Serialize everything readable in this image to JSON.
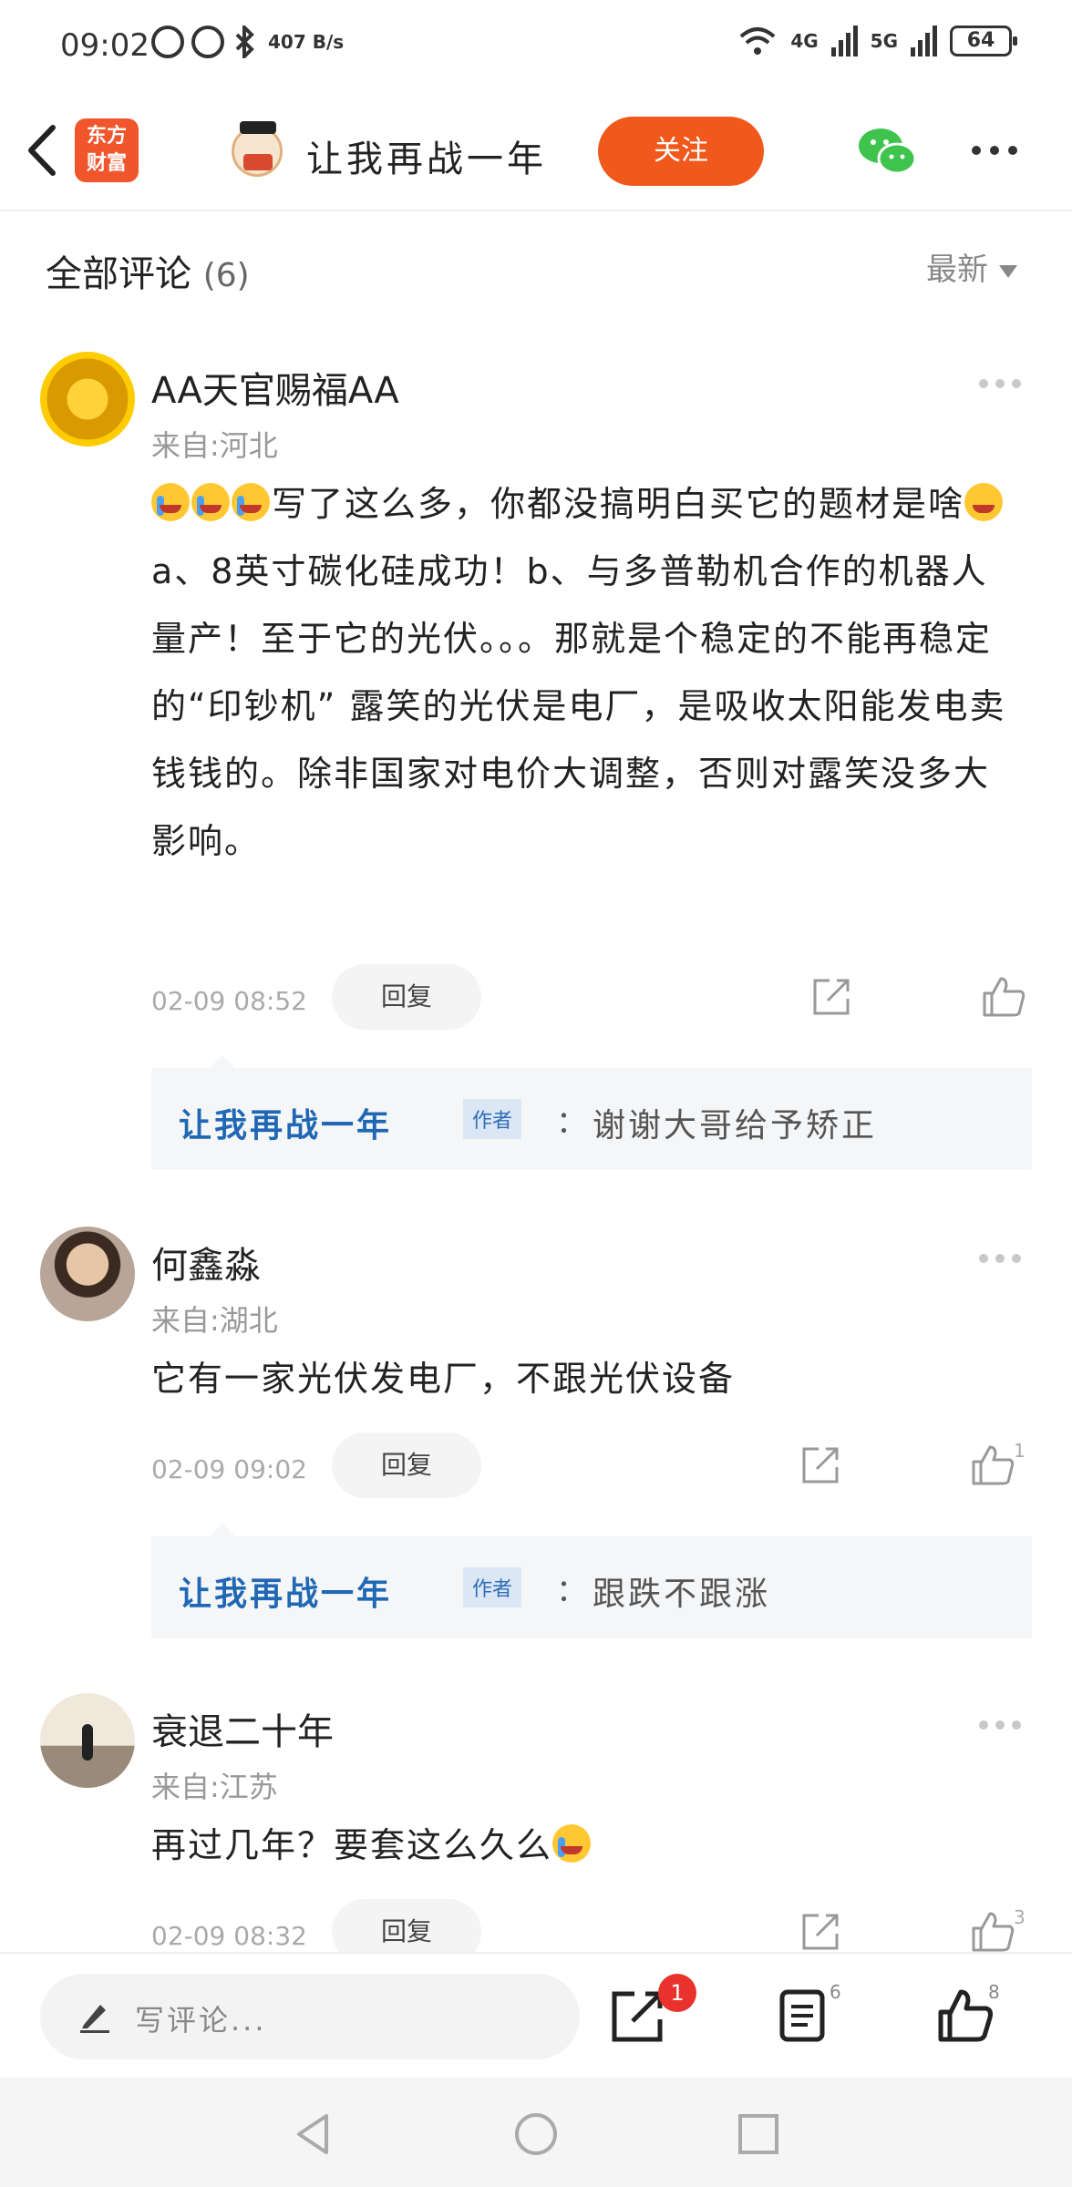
{
  "status_bar": {
    "time": "09:02",
    "net_speed": "407 B/s",
    "net_4g": "4G",
    "net_5g": "5G",
    "battery": "64"
  },
  "header": {
    "logo_text_1": "东方",
    "logo_text_2": "财富",
    "title": "让我再战一年",
    "follow_label": "关注"
  },
  "section": {
    "title": "全部评论",
    "count": "(6)",
    "sort_label": "最新"
  },
  "comments": [
    {
      "name": "AA天官赐福AA",
      "location": "来自:河北",
      "text": "写了这么多，你都没搞明白买它的题材是啥",
      "text_2": "a、8英寸碳化硅成功！b、与多普勒机合作的机器人量产！至于它的光伏。。。那就是个稳定的不能再稳定的“印钞机” 露笑的光伏是电厂，是吸收太阳能发电卖钱钱的。除非国家对电价大调整，否则对露笑没多大影响。",
      "time": "02-09  08:52",
      "reply_label": "回复",
      "likes": "",
      "reply": {
        "author": "让我再战一年",
        "tag": "作者",
        "colon": "：",
        "text": "谢谢大哥给予矫正"
      }
    },
    {
      "name": "何鑫淼",
      "location": "来自:湖北",
      "text": "它有一家光伏发电厂，不跟光伏设备",
      "time": "02-09  09:02",
      "reply_label": "回复",
      "likes": "1",
      "reply": {
        "author": "让我再战一年",
        "tag": "作者",
        "colon": "：",
        "text": "跟跌不跟涨"
      }
    },
    {
      "name": "衰退二十年",
      "location": "来自:江苏",
      "text": "再过几年？要套这么久么",
      "time": "02-09  08:32",
      "reply_label": "回复",
      "likes": "3"
    }
  ],
  "bottom_bar": {
    "placeholder": "写评论...",
    "share_badge": "1",
    "comments_count": "6",
    "likes_count": "8"
  },
  "icons": {
    "back": "back-arrow-icon",
    "wechat": "wechat-icon",
    "more": "more-dots-icon",
    "share": "share-icon",
    "like": "thumbs-up-icon",
    "pen": "pen-icon",
    "list": "comment-list-icon"
  },
  "colors": {
    "accent": "#f1581c",
    "author_link": "#2168b4",
    "badge": "#e8322b"
  }
}
